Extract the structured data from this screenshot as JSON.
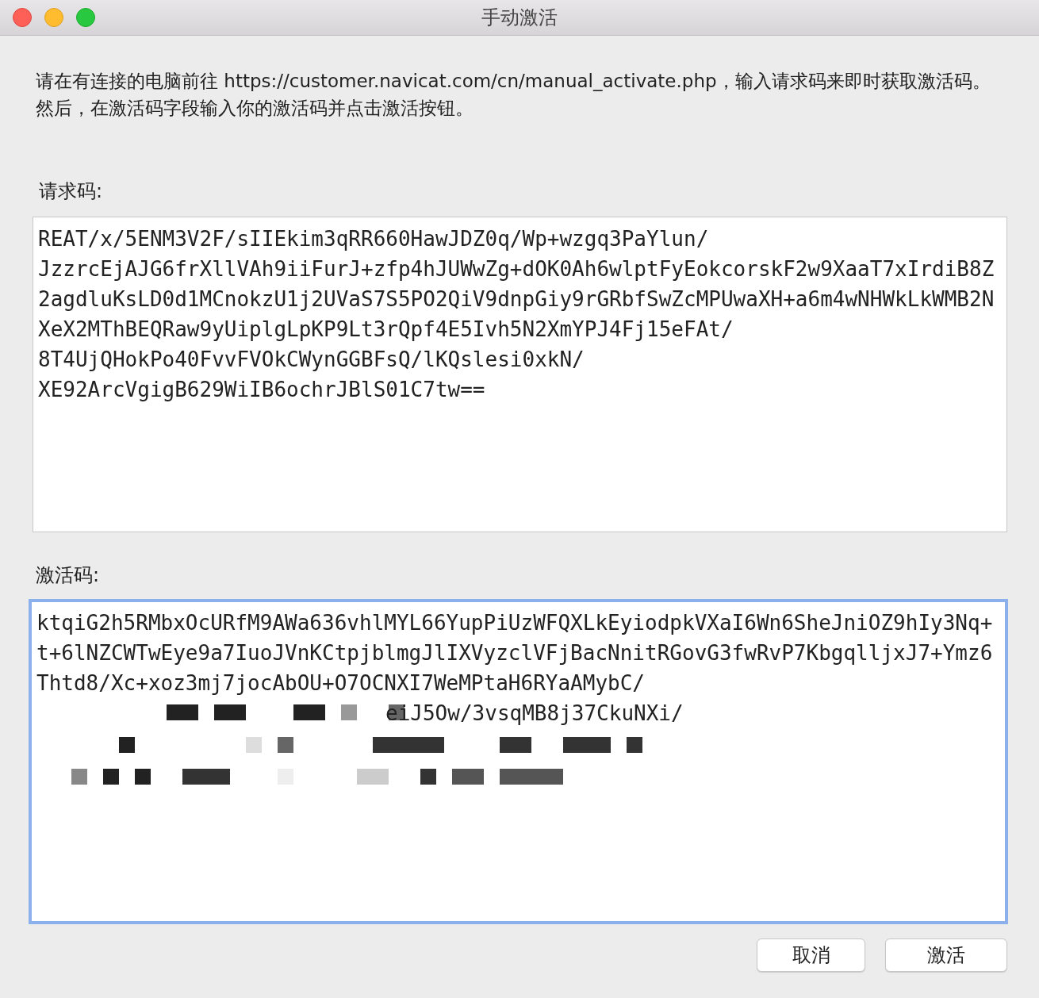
{
  "window": {
    "title": "手动激活"
  },
  "instructions": "请在有连接的电脑前往 https://customer.navicat.com/cn/manual_activate.php，输入请求码来即时获取激活码。然后，在激活码字段输入你的激活码并点击激活按钮。",
  "request_code": {
    "label": "请求码:",
    "lines": [
      "REAT/x/5ENM3V2F/sIIEkim3qRR660HawJDZ0q/Wp+wzgq3PaYlun/",
      "JzzrcEjAJG6frXllVAh9iiFurJ+zfp4hJUWwZg+dOK0Ah6wlptFyEokcorskF2w9XaaT7xIrdiB8Z",
      "2agdluKsLD0d1MCnokzU1j2UVaS7S5PO2QiV9dnpGiy9rGRbfSwZcMPUwaXH+a6m4wNHWkLkWMB2N",
      "XeX2MThBEQRaw9yUiplgLpKP9Lt3rQpf4E5Ivh5N2XmYPJ4Fj15eFAt/",
      "8T4UjQHokPo40FvvFVOkCWynGGBFsQ/lKQslesi0xkN/",
      "XE92ArcVgigB629WiIB6ochrJBlS01C7tw=="
    ]
  },
  "activation_code": {
    "label": "激活码:",
    "focused": true,
    "lines": [
      "ktqiG2h5RMbxOcURfM9AWa636vhlMYL66YupPiUzWFQXLkEyiodpkVXaI6Wn6SheJniOZ9hIy3Nq+",
      "t+6lNZCWTwEye9a7IuoJVnKCtpjblmgJlIXVyzclVFjBacNnitRGovG3fwRvP7KbgqlljxJ7+Ymz6",
      "Thtd8/Xc+xoz3mj7jocAbOU+O7OCNXI7WeMPtaH6RYaAMybC/"
    ],
    "partial_line": "eiJ5Ow/3vsqMB8j37CkuNXi/"
  },
  "buttons": [
    {
      "label": "取消",
      "kind": "cancel"
    },
    {
      "label": "激活",
      "kind": "activate"
    }
  ]
}
